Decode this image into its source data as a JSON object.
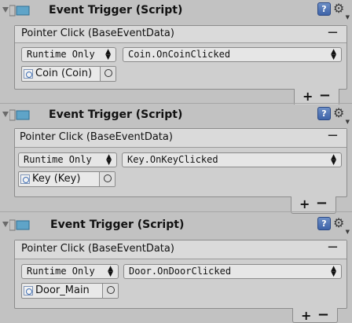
{
  "components": [
    {
      "title": "Event Trigger (Script)",
      "event_header": "Pointer Click (BaseEventData)",
      "call_state": "Runtime Only",
      "function": "Coin.OnCoinClicked",
      "target_object": "Coin (Coin)"
    },
    {
      "title": "Event Trigger (Script)",
      "event_header": "Pointer Click (BaseEventData)",
      "call_state": "Runtime Only",
      "function": "Key.OnKeyClicked",
      "target_object": "Key (Key)"
    },
    {
      "title": "Event Trigger (Script)",
      "event_header": "Pointer Click (BaseEventData)",
      "call_state": "Runtime Only",
      "function": "Door.OnDoorClicked",
      "target_object": "Door_Main"
    }
  ],
  "icons": {
    "foldout": "foldout-arrow-icon",
    "script": "script-icon",
    "help": "help-icon",
    "settings": "gear-icon",
    "object": "object-field-icon",
    "picker": "object-picker-icon"
  },
  "labels": {
    "add": "+",
    "remove": "−",
    "help_glyph": "?"
  },
  "colors": {
    "background": "#c2c2c2",
    "panel": "#cfcfcf",
    "accent": "#3e63a8"
  }
}
